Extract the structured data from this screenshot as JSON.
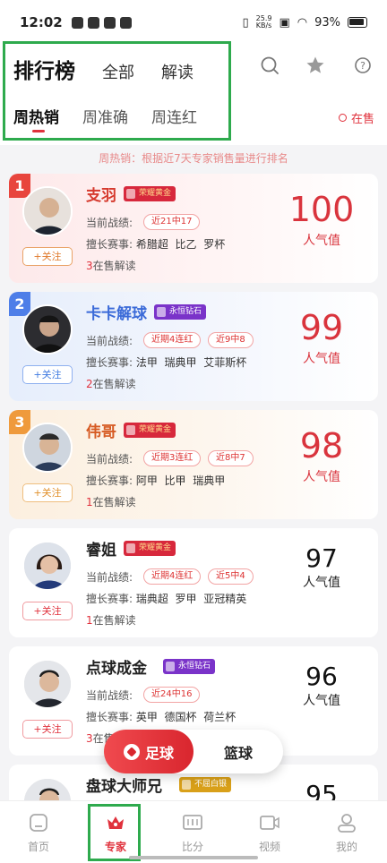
{
  "status_bar": {
    "time": "12:02",
    "net_speed_top": "25.9",
    "net_speed_unit": "KB/s",
    "battery": "93%"
  },
  "header": {
    "tabs": [
      "排行榜",
      "全部",
      "解读"
    ],
    "sub_tabs": [
      "周热销",
      "周准确",
      "周连红"
    ],
    "onsale_filter": "在售",
    "icons": [
      "search-icon",
      "star-icon",
      "help-icon"
    ]
  },
  "description": "周热销：根据近7天专家销售量进行排名",
  "labels": {
    "record": "当前战绩:",
    "specialty": "擅长赛事:",
    "onsale_suffix": "在售解读",
    "popularity": "人气值",
    "follow": "+关注"
  },
  "experts": [
    {
      "rank": "1",
      "name": "支羽",
      "honor": "荣耀黄金",
      "chips": [
        "近21中17"
      ],
      "specialties": [
        "希腊超",
        "比乙",
        "罗杯"
      ],
      "onsale_count": "3",
      "popularity": "100"
    },
    {
      "rank": "2",
      "name": "卡卡解球",
      "honor": "永恒钻石",
      "chips": [
        "近期4连红",
        "近9中8"
      ],
      "specialties": [
        "法甲",
        "瑞典甲",
        "艾菲斯杯"
      ],
      "onsale_count": "2",
      "popularity": "99"
    },
    {
      "rank": "3",
      "name": "伟哥",
      "honor": "荣耀黄金",
      "chips": [
        "近期3连红",
        "近8中7"
      ],
      "specialties": [
        "阿甲",
        "比甲",
        "瑞典甲"
      ],
      "onsale_count": "1",
      "popularity": "98"
    },
    {
      "rank": "",
      "name": "睿姐",
      "honor": "荣耀黄金",
      "chips": [
        "近期4连红",
        "近5中4"
      ],
      "specialties": [
        "瑞典超",
        "罗甲",
        "亚冠精英"
      ],
      "onsale_count": "1",
      "popularity": "97"
    },
    {
      "rank": "",
      "name": "点球成金",
      "honor": "永恒钻石",
      "chips": [
        "近24中16"
      ],
      "specialties": [
        "英甲",
        "德国杯",
        "荷兰杯"
      ],
      "onsale_count": "3",
      "popularity": "96"
    },
    {
      "rank": "",
      "name": "盘球大师兄",
      "honor": "不屈白银",
      "chips": [],
      "specialties": [],
      "onsale_count": "",
      "popularity": "95"
    }
  ],
  "sport_toggle": {
    "active": "足球",
    "other": "篮球"
  },
  "tabbar": [
    {
      "label": "首页",
      "icon": "home-icon"
    },
    {
      "label": "专家",
      "icon": "crown-icon"
    },
    {
      "label": "比分",
      "icon": "scoreboard-icon"
    },
    {
      "label": "视频",
      "icon": "video-icon"
    },
    {
      "label": "我的",
      "icon": "profile-icon"
    }
  ],
  "colors": {
    "accent": "#e0313c",
    "highlight_frame": "#2eaa4d"
  }
}
